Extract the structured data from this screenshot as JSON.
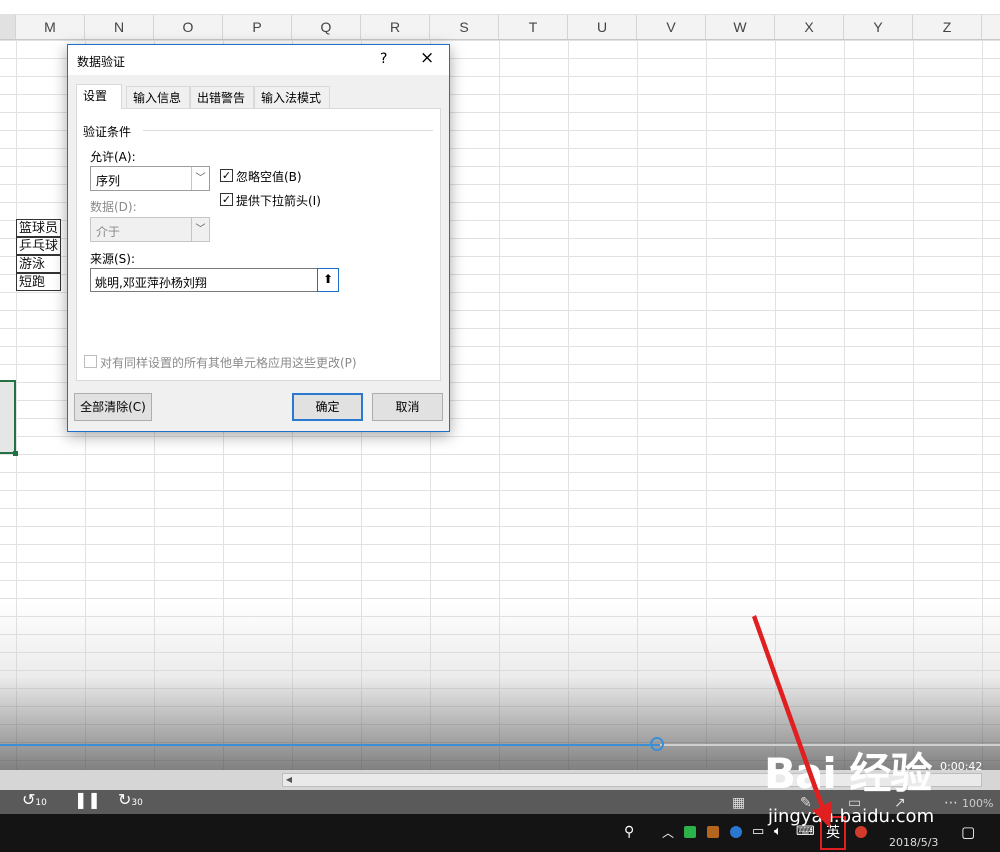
{
  "spreadsheet": {
    "columns": [
      "M",
      "N",
      "O",
      "P",
      "Q",
      "R",
      "S",
      "T",
      "U",
      "V",
      "W",
      "X",
      "Y",
      "Z"
    ],
    "cells": [
      "篮球员",
      "乒乓球",
      "游泳",
      "短跑"
    ]
  },
  "dialog": {
    "title": "数据验证",
    "help": "?",
    "close": "×",
    "tabs": [
      "设置",
      "输入信息",
      "出错警告",
      "输入法模式"
    ],
    "section_label": "验证条件",
    "allow_label": "允许(A):",
    "allow_value": "序列",
    "data_label": "数据(D):",
    "data_value": "介于",
    "ignore_blank_label": "忽略空值(B)",
    "ignore_blank_checked": true,
    "dropdown_label": "提供下拉箭头(I)",
    "dropdown_checked": true,
    "source_label": "来源(S):",
    "source_value": "姚明,邓亚萍孙杨刘翔",
    "apply_all_label": "对有同样设置的所有其他单元格应用这些更改(P)",
    "clear_all_button": "全部清除(C)",
    "ok_button": "确定",
    "cancel_button": "取消"
  },
  "video": {
    "timecode": "0:00:42",
    "rewind_label": "10",
    "forward_label": "30",
    "progress": 0.66
  },
  "taskbar": {
    "ime": "英",
    "date": "2018/5/3",
    "zoom": "100%"
  },
  "watermark": {
    "main": "Bai 经验",
    "sub": "jingyan.baidu.com"
  },
  "colors": {
    "accent": "#1e6fc9",
    "selection": "#217346",
    "annotation": "#e02020"
  }
}
